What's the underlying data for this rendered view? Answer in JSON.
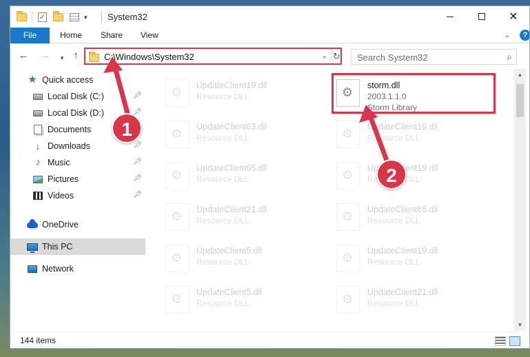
{
  "window": {
    "title": "System32"
  },
  "ribbon": {
    "file": "File",
    "home": "Home",
    "share": "Share",
    "view": "View",
    "help": "?"
  },
  "nav": {
    "back": "←",
    "forward": "→",
    "recent": "▾",
    "up": "↑",
    "address": "C:\\Windows\\System32",
    "search_placeholder": "Search System32"
  },
  "sidebar": {
    "items": [
      {
        "label": "Quick access",
        "icon": "star-icon",
        "pinned": false
      },
      {
        "label": "Local Disk (C:)",
        "icon": "disk-icon",
        "pinned": true
      },
      {
        "label": "Local Disk (D:)",
        "icon": "disk-icon",
        "pinned": true
      },
      {
        "label": "Documents",
        "icon": "documents-icon",
        "pinned": true
      },
      {
        "label": "Downloads",
        "icon": "download-icon",
        "pinned": true
      },
      {
        "label": "Music",
        "icon": "music-icon",
        "pinned": true
      },
      {
        "label": "Pictures",
        "icon": "pictures-icon",
        "pinned": true
      },
      {
        "label": "Videos",
        "icon": "videos-icon",
        "pinned": true
      },
      {
        "label": "OneDrive",
        "icon": "cloud-icon",
        "pinned": false
      },
      {
        "label": "This PC",
        "icon": "pc-icon",
        "pinned": false,
        "selected": true
      },
      {
        "label": "Network",
        "icon": "network-icon",
        "pinned": false
      }
    ]
  },
  "files": {
    "highlighted": {
      "name": "storm.dll",
      "version": "2003.1.1.0",
      "type": "Storm Library"
    },
    "left_column": [
      {
        "name": "UpdateClient19.dll",
        "type": "Resource DLL"
      },
      {
        "name": "UpdateClient63.dll",
        "type": "Resource DLL"
      },
      {
        "name": "UpdateClient65.dll",
        "type": "Resource DLL"
      },
      {
        "name": "UpdateClient21.dll",
        "type": "Resource DLL"
      },
      {
        "name": "UpdateClient5.dll",
        "type": "Resource DLL"
      },
      {
        "name": "UpdateClient5.dll",
        "type": "Resource DLL"
      }
    ],
    "right_column": [
      {
        "name": "UpdateClient19.dll",
        "type": "Resource DLL"
      },
      {
        "name": "UpdateClient19.dll",
        "type": "Resource DLL"
      },
      {
        "name": "UpdateClient65.dll",
        "type": "Resource DLL"
      },
      {
        "name": "UpdateClient19.dll",
        "type": "Resource DLL"
      },
      {
        "name": "UpdateClient21.dll",
        "type": "Resource DLL"
      }
    ]
  },
  "status": {
    "count": "144 items"
  },
  "annotations": {
    "step1": "1",
    "step2": "2",
    "accent": "#d9364a"
  }
}
